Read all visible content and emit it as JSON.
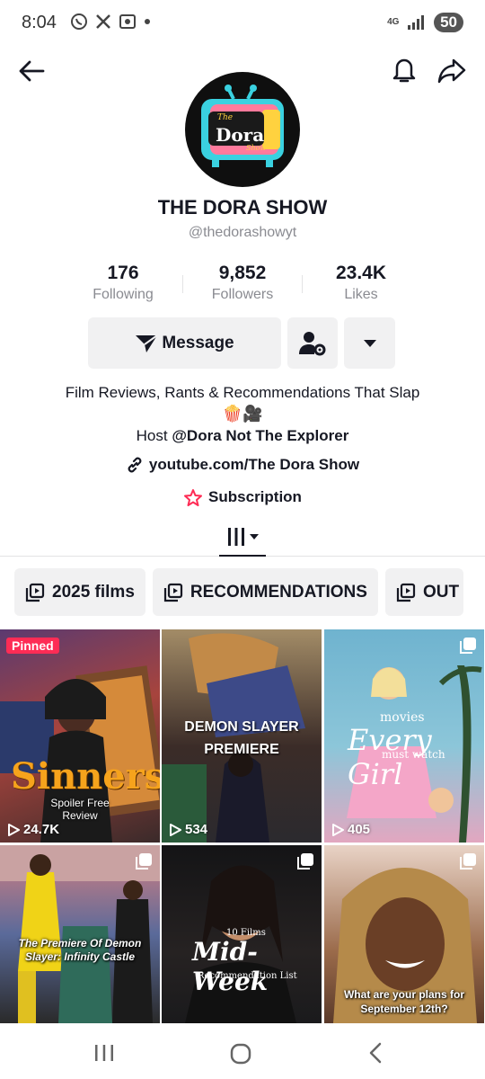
{
  "status_bar": {
    "time": "8:04",
    "battery": "50",
    "network": "4G"
  },
  "profile": {
    "avatar_text_top": "The",
    "avatar_text_main": "Dora",
    "avatar_text_bottom": "Show",
    "name": "THE DORA SHOW",
    "handle": "@thedorashowyt",
    "stats": [
      {
        "value": "176",
        "label": "Following"
      },
      {
        "value": "9,852",
        "label": "Followers"
      },
      {
        "value": "23.4K",
        "label": "Likes"
      }
    ],
    "message_label": "Message",
    "bio_line1": "Film Reviews, Rants & Recommendations That Slap",
    "bio_line2": "🍿🎥",
    "bio_line3_prefix": "Host ",
    "bio_line3_mention": "@Dora Not The Explorer",
    "link": "youtube.com/The Dora Show",
    "subscription": "Subscription"
  },
  "playlists": [
    {
      "label": "2025 films"
    },
    {
      "label": "RECOMMENDATIONS"
    },
    {
      "label": "OUT"
    }
  ],
  "videos": [
    {
      "badge": "Pinned",
      "title": "Sinners",
      "subtitle": "Spoiler Free Review",
      "views": "24.7K"
    },
    {
      "title": "DEMON SLAYER PREMIERE",
      "views": "534"
    },
    {
      "title": "Every Girl",
      "title_top": "movies",
      "title_bottom": "must watch",
      "views": "405"
    },
    {
      "title": "The Premiere Of Demon Slayer: Infinity Castle"
    },
    {
      "title": "Mid-Week",
      "title_top": "10 Films",
      "title_bottom": "Recommendation List"
    },
    {
      "title": "What are your plans for September 12th?"
    }
  ],
  "colors": {
    "accent": "#fe2c55",
    "chip_bg": "#f1f1f2",
    "muted_text": "#8a8b91"
  }
}
